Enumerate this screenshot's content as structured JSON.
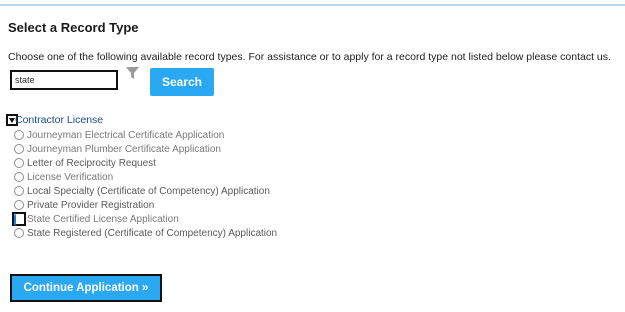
{
  "page": {
    "title": "Select a Record Type",
    "instructions": "Choose one of the following available record types. For assistance or to apply for a record type not listed below please contact us."
  },
  "search": {
    "value": "state",
    "button_label": "Search"
  },
  "icons": {
    "filter": "filter-icon",
    "collapse": "chevron-down-icon"
  },
  "group": {
    "label": "Contractor License",
    "options": [
      {
        "label": "Journeyman Electrical Certificate Application",
        "selected": false
      },
      {
        "label": "Journeyman Plumber Certificate Application",
        "selected": false
      },
      {
        "label": "Letter of Reciprocity Request",
        "selected": false
      },
      {
        "label": "License Verification",
        "selected": false
      },
      {
        "label": "Local Specialty (Certificate of Competency) Application",
        "selected": false
      },
      {
        "label": "Private Provider Registration",
        "selected": false
      },
      {
        "label": "State Certified License Application",
        "selected": true
      },
      {
        "label": "State Registered (Certificate of Competency) Application",
        "selected": false
      }
    ]
  },
  "actions": {
    "continue_label": "Continue Application »"
  },
  "colors": {
    "accent": "#2aa8f2",
    "group_link": "#1a4c8a",
    "selected_radio": "#1e7fd6",
    "top_rule": "#b9d9ee"
  }
}
